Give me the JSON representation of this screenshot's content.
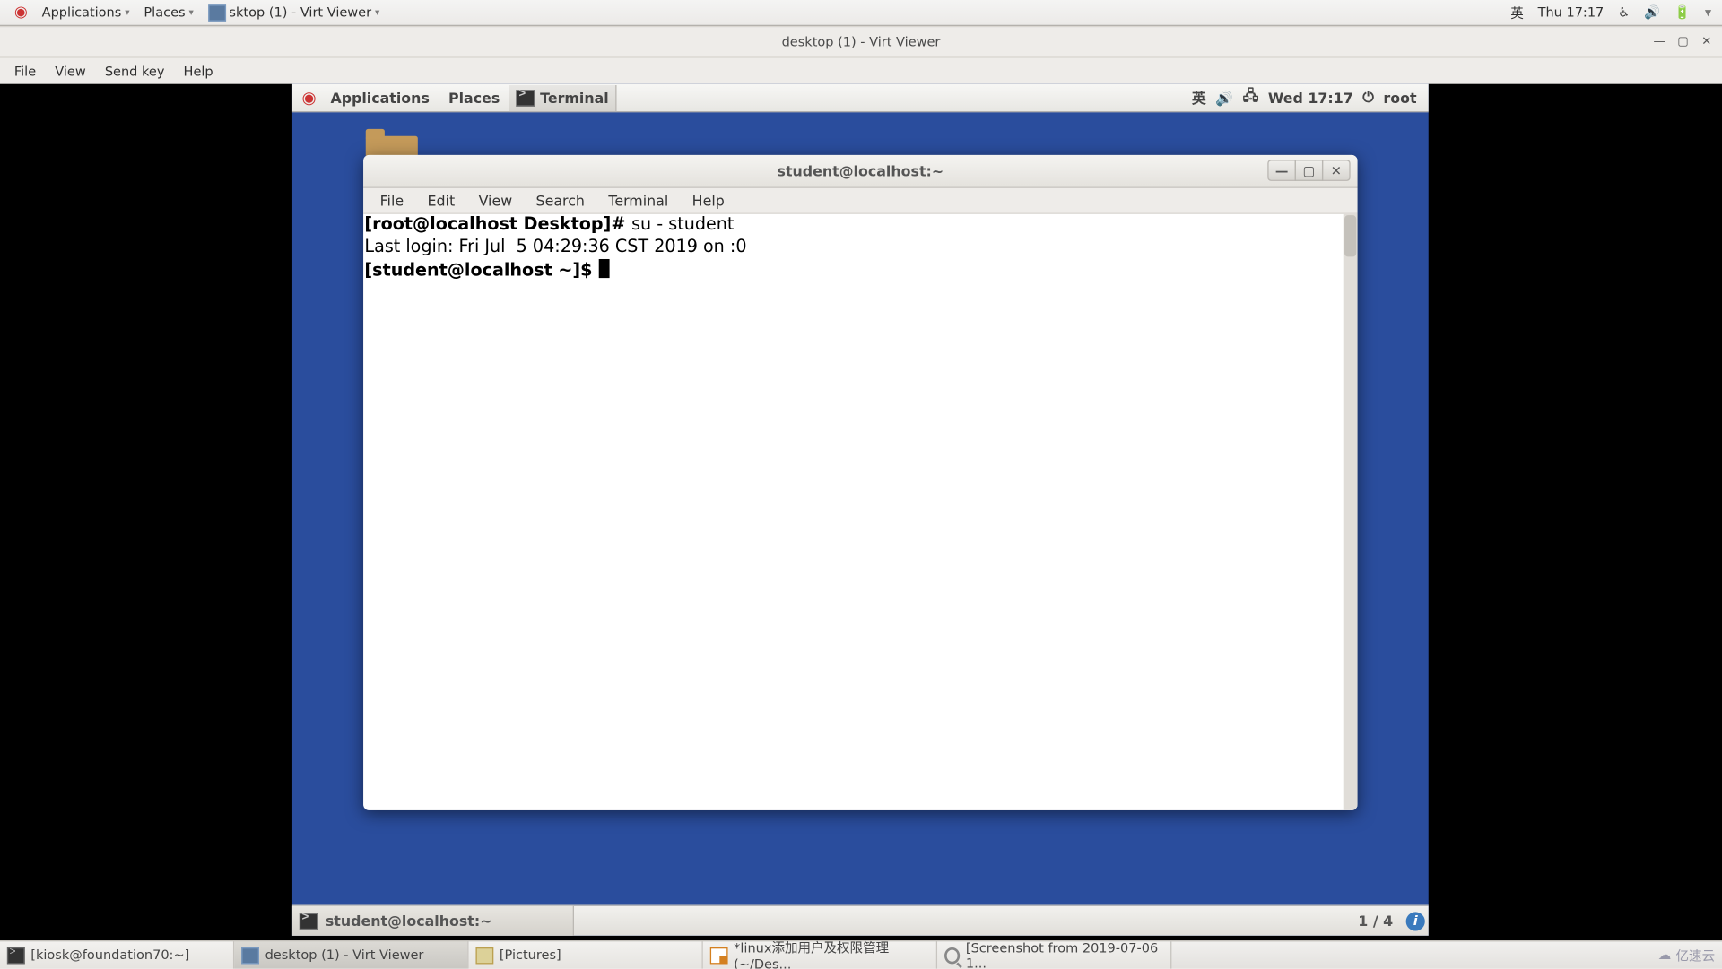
{
  "host": {
    "panel": {
      "applications": "Applications",
      "places": "Places",
      "task_label": "sktop (1) - Virt Viewer",
      "ime": "英",
      "clock": "Thu 17:17"
    },
    "taskbar": {
      "items": [
        "[kiosk@foundation70:~]",
        "desktop (1) - Virt Viewer",
        "[Pictures]",
        "*linux添加用户及权限管理 (~/Des...",
        "[Screenshot from 2019-07-06 1..."
      ]
    },
    "watermark": {
      "site": "亿速云"
    }
  },
  "vv": {
    "title": "desktop (1) - Virt Viewer",
    "menus": [
      "File",
      "View",
      "Send key",
      "Help"
    ]
  },
  "guest": {
    "panel": {
      "applications": "Applications",
      "places": "Places",
      "task": "Terminal",
      "ime": "英",
      "clock": "Wed 17:17",
      "user": "root"
    },
    "bottom": {
      "task": "student@localhost:~",
      "pager": "1 / 4"
    },
    "terminal": {
      "title": "student@localhost:~",
      "menus": [
        "File",
        "Edit",
        "View",
        "Search",
        "Terminal",
        "Help"
      ],
      "lines": {
        "l0_prompt": "[root@localhost Desktop]# ",
        "l0_cmd": "su - student",
        "l1": "Last login: Fri Jul  5 04:29:36 CST 2019 on :0",
        "l2": "[student@localhost ~]$ "
      }
    }
  }
}
